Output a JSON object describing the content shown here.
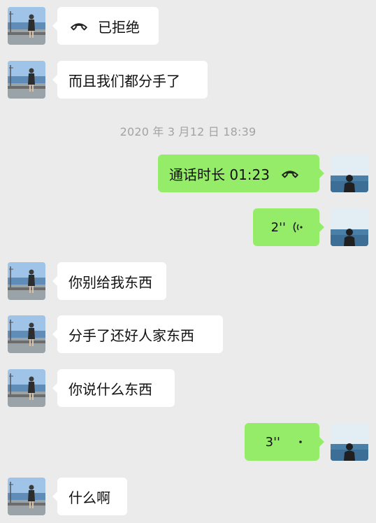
{
  "messages": [
    {
      "side": "left",
      "text": "已拒绝",
      "icon": "phone-hangup-icon"
    },
    {
      "side": "left",
      "text": "而且我们都分手了"
    },
    {
      "side": "right",
      "text": "通话时长 01:23",
      "icon": "phone-hangup-icon"
    },
    {
      "side": "right",
      "text": "2''",
      "icon": "voice-wave-icon"
    },
    {
      "side": "left",
      "text": "你别给我东西"
    },
    {
      "side": "left",
      "text": "分手了还好人家东西"
    },
    {
      "side": "left",
      "text": "你说什么东西"
    },
    {
      "side": "right",
      "text": "3''",
      "icon": "voice-play-icon"
    },
    {
      "side": "left",
      "text": "什么啊"
    }
  ],
  "timestamp": "2020 年 3 月12 日 18:39",
  "colors": {
    "background": "#ebebeb",
    "incoming": "#ffffff",
    "outgoing": "#95ec69",
    "timestamp": "#a3a3a3"
  }
}
